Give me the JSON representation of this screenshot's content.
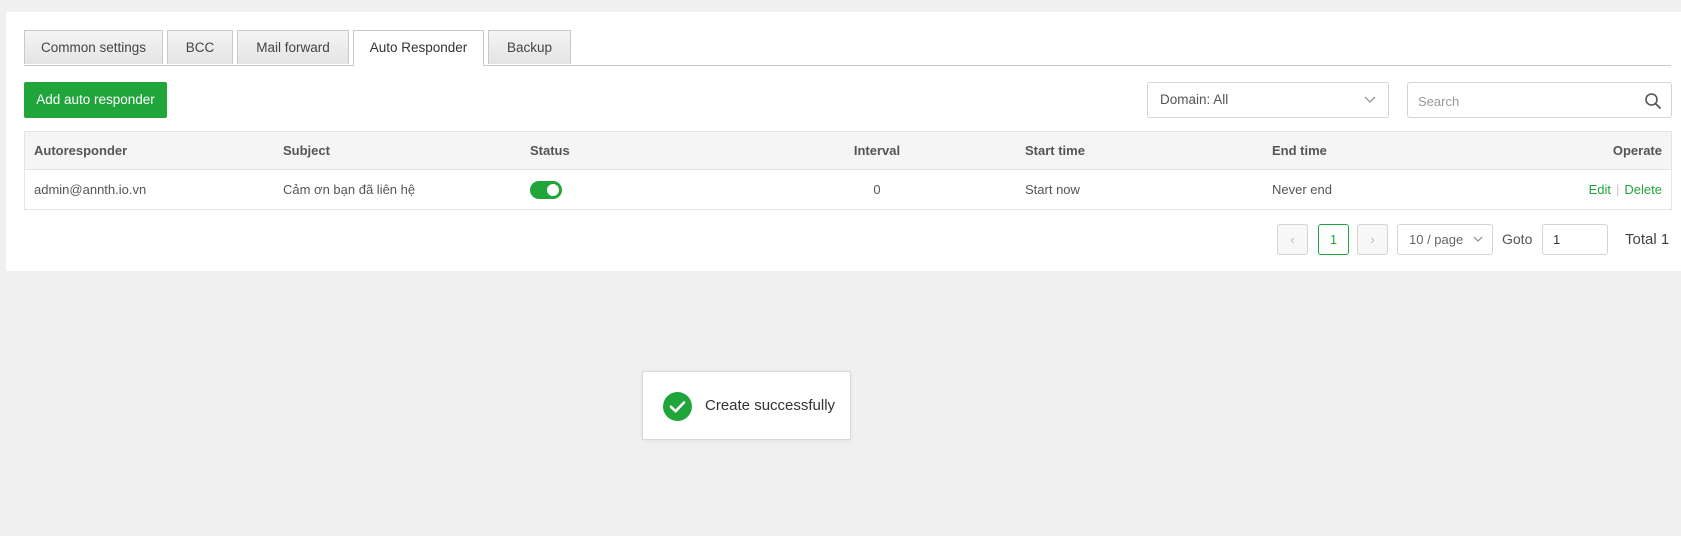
{
  "tabs": [
    {
      "label": "Common settings",
      "active": false
    },
    {
      "label": "BCC",
      "active": false
    },
    {
      "label": "Mail forward",
      "active": false
    },
    {
      "label": "Auto Responder",
      "active": true
    },
    {
      "label": "Backup",
      "active": false
    }
  ],
  "toolbar": {
    "add_label": "Add auto responder",
    "domain_select": "Domain: All",
    "search_placeholder": "Search"
  },
  "table": {
    "headers": [
      "Autoresponder",
      "Subject",
      "Status",
      "Interval",
      "Start time",
      "End time",
      "Operate"
    ],
    "rows": [
      {
        "autoresponder": "admin@annth.io.vn",
        "subject": "Cảm ơn bạn đã liên hệ",
        "status_on": true,
        "interval": "0",
        "start_time": "Start now",
        "end_time": "Never end",
        "edit_label": "Edit",
        "delete_label": "Delete"
      }
    ]
  },
  "pagination": {
    "prev": "‹",
    "current_page": "1",
    "next": "›",
    "page_size": "10 / page",
    "goto_label": "Goto",
    "goto_value": "1",
    "total": "Total 1"
  },
  "toast": {
    "message": "Create successfully"
  },
  "colors": {
    "accent": "#20a53a",
    "background": "#f0f0f0"
  },
  "icons": {
    "search": "search-icon",
    "chevron": "chevron-down-icon",
    "success": "check-circle-icon"
  }
}
